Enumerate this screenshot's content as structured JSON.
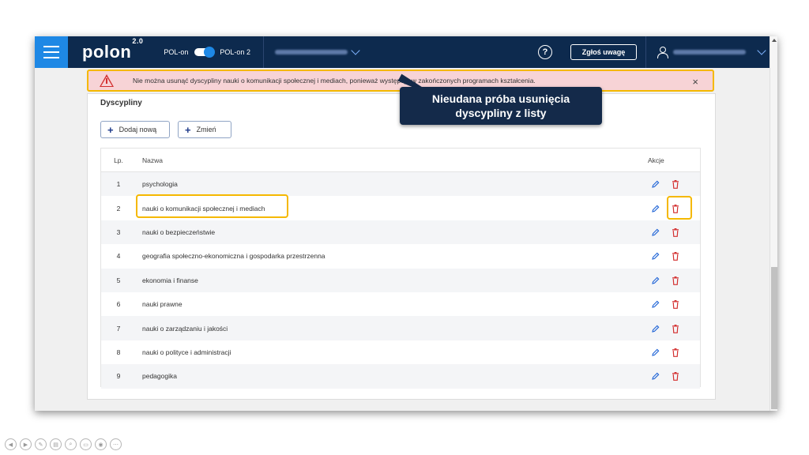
{
  "topbar": {
    "logo": "polon",
    "logo_version": "2.0",
    "toggle_left": "POL-on",
    "toggle_right": "POL-on 2",
    "help_label": "?",
    "report_label": "Zgłoś uwagę"
  },
  "alert": {
    "message": "Nie można usunąć dyscypliny nauki o komunikacji społecznej i mediach, ponieważ występuje w zakończonych programach kształcenia.",
    "close": "×"
  },
  "card": {
    "title": "Dyscypliny",
    "add_label": "Dodaj nową",
    "change_label": "Zmień"
  },
  "table": {
    "headers": {
      "lp": "Lp.",
      "name": "Nazwa",
      "actions": "Akcje"
    },
    "rows": [
      {
        "lp": "1",
        "name": "psychologia"
      },
      {
        "lp": "2",
        "name": "nauki o komunikacji społecznej i mediach"
      },
      {
        "lp": "3",
        "name": "nauki o bezpieczeństwie"
      },
      {
        "lp": "4",
        "name": "geografia społeczno-ekonomiczna i gospodarka przestrzenna"
      },
      {
        "lp": "5",
        "name": "ekonomia i finanse"
      },
      {
        "lp": "6",
        "name": "nauki prawne"
      },
      {
        "lp": "7",
        "name": "nauki o zarządzaniu i jakości"
      },
      {
        "lp": "8",
        "name": "nauki o polityce i administracji"
      },
      {
        "lp": "9",
        "name": "pedagogika"
      }
    ]
  },
  "callout": {
    "line1": "Nieudana próba usunięcia",
    "line2": "dyscypliny z listy"
  },
  "colors": {
    "topbar": "#0d2a4e",
    "accent": "#1e88e5",
    "alert_bg": "#f7d3d6",
    "highlight": "#f5b800",
    "delete": "#d32f2f",
    "edit": "#1e63d6"
  },
  "icons": [
    "menu-icon",
    "warning-icon",
    "close-icon",
    "help-icon",
    "user-icon",
    "chevron-down-icon",
    "plus-icon",
    "pencil-icon",
    "trash-icon"
  ]
}
